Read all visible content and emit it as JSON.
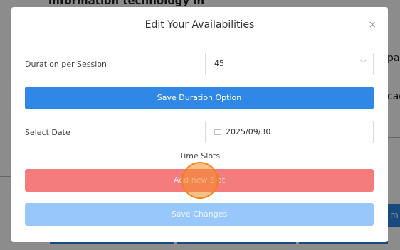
{
  "background": {
    "heading_fragment": "information technology in",
    "right_fragment_1": "pai",
    "right_fragment_2": "cad",
    "right_button_fragment": "m"
  },
  "modal": {
    "title": "Edit Your Availabilities",
    "close_glyph": "×",
    "duration": {
      "label": "Duration per Session",
      "value": "45",
      "chevron_glyph": "﹀"
    },
    "save_duration_label": "Save Duration Option",
    "date": {
      "label": "Select Date",
      "value": "2025/09/30"
    },
    "time_slots_label": "Time Slots",
    "add_slot_label": "Add new Slot",
    "save_changes_label": "Save Changes"
  },
  "colors": {
    "primary": "#2f87e6",
    "danger": "#f47c7c",
    "primary_disabled": "#98c7fb",
    "click_indicator": "#f48c28"
  }
}
